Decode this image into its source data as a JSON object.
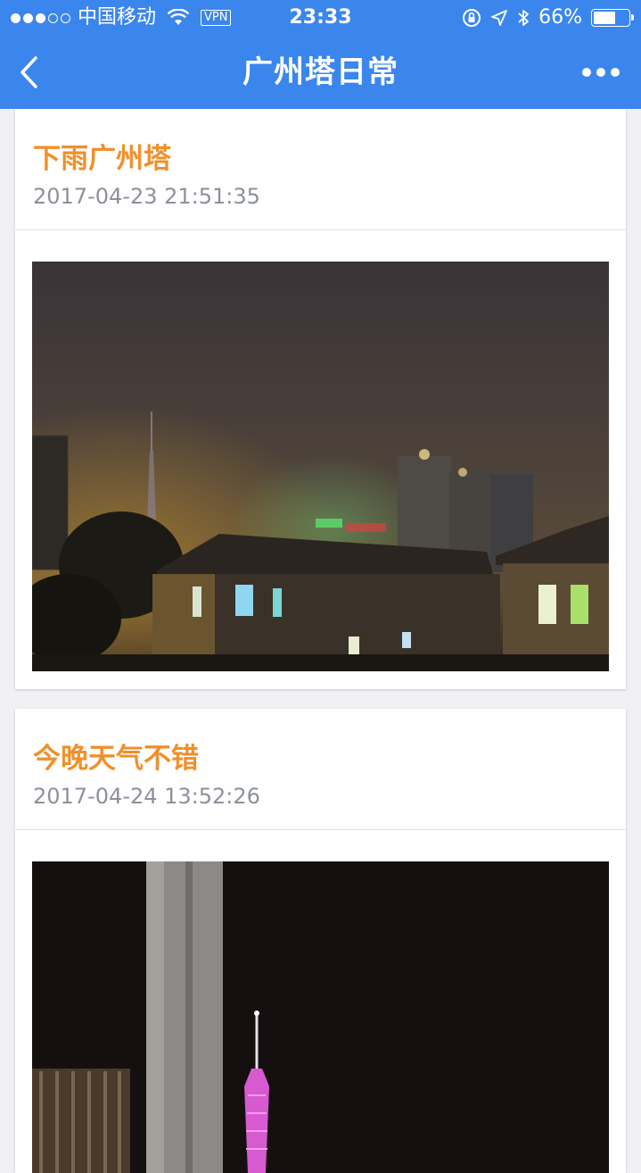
{
  "status_bar": {
    "carrier": "中国移动",
    "vpn": "VPN",
    "time": "23:33",
    "battery": "66%",
    "battery_level": 0.66
  },
  "nav": {
    "title": "广州塔日常"
  },
  "posts": [
    {
      "title": "下雨广州塔",
      "time": "2017-04-23 21:51:35",
      "photo": "photo of Canton Tower in rain at night"
    },
    {
      "title": "今晚天气不错",
      "time": "2017-04-24 13:52:26",
      "photo": "photo of illuminated Canton Tower at night"
    }
  ],
  "colors": {
    "header": "#3b86ec",
    "title_accent": "#f0902b",
    "time_text": "#8c919a"
  }
}
